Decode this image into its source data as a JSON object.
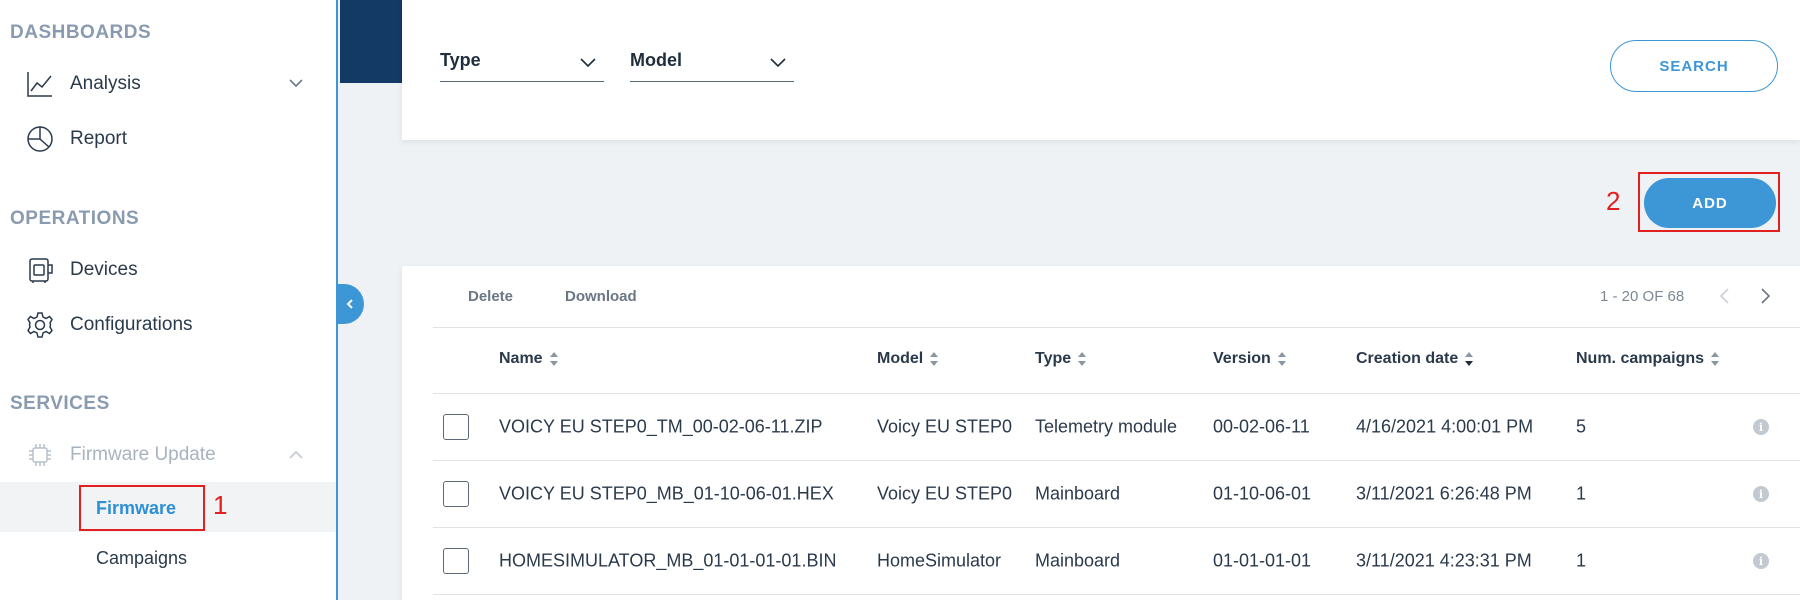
{
  "sidebar": {
    "sections": {
      "dashboards": "DASHBOARDS",
      "operations": "OPERATIONS",
      "services": "SERVICES"
    },
    "items": {
      "analysis": "Analysis",
      "report": "Report",
      "devices": "Devices",
      "configurations": "Configurations",
      "firmware_update": "Firmware Update",
      "firmware": "Firmware",
      "campaigns": "Campaigns"
    }
  },
  "filters": {
    "type_label": "Type",
    "model_label": "Model",
    "search_label": "SEARCH"
  },
  "add_label": "ADD",
  "annotations": {
    "step1": "1",
    "step2": "2"
  },
  "annotation_color": "#e32020",
  "accent_color": "#3d96d6",
  "toolbar": {
    "delete": "Delete",
    "download": "Download",
    "pager": "1 - 20 OF 68"
  },
  "table": {
    "columns": [
      "Name",
      "Model",
      "Type",
      "Version",
      "Creation date",
      "Num. campaigns"
    ],
    "rows": [
      [
        "VOICY EU STEP0_TM_00-02-06-11.ZIP",
        "Voicy EU STEP0",
        "Telemetry module",
        "00-02-06-11",
        "4/16/2021 4:00:01 PM",
        "5"
      ],
      [
        "VOICY EU STEP0_MB_01-10-06-01.HEX",
        "Voicy EU STEP0",
        "Mainboard",
        "01-10-06-01",
        "3/11/2021 6:26:48 PM",
        "1"
      ],
      [
        "HOMESIMULATOR_MB_01-01-01-01.BIN",
        "HomeSimulator",
        "Mainboard",
        "01-01-01-01",
        "3/11/2021 4:23:31 PM",
        "1"
      ]
    ]
  }
}
